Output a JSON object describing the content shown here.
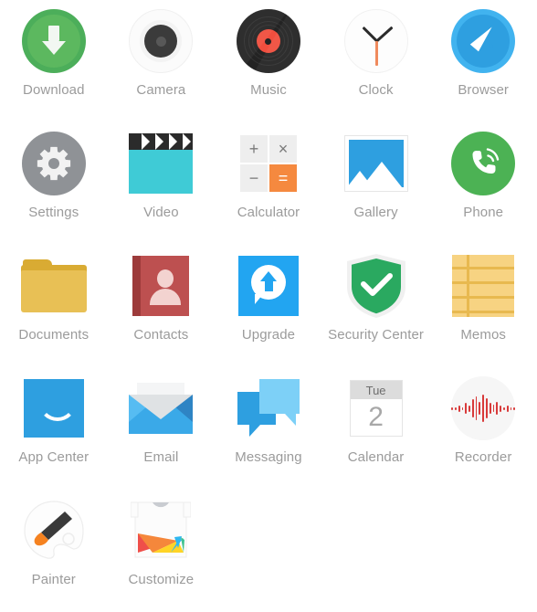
{
  "screen": {
    "name": "app-drawer",
    "background": "#ffffff",
    "columns": 5
  },
  "apps": [
    {
      "label": "Download",
      "icon": "download-icon",
      "colors": {
        "ring": "#4cae5a",
        "fill": "#5cb85f",
        "arrow": "#f2f7f2"
      }
    },
    {
      "label": "Camera",
      "icon": "camera-icon",
      "colors": {
        "ring": "#f3f3f3",
        "lens": "#3b3b3b",
        "pupil": "#585858"
      }
    },
    {
      "label": "Music",
      "icon": "music-icon",
      "colors": {
        "disc": "#232323",
        "label": "#f04e3e"
      }
    },
    {
      "label": "Clock",
      "icon": "clock-icon",
      "colors": {
        "face": "#fdfdfd",
        "hands": "#2b2b2b",
        "second": "#f08a5d"
      }
    },
    {
      "label": "Browser",
      "icon": "compass-icon",
      "colors": {
        "body": "#2e9fe0",
        "ring": "#41b3ef",
        "needle": "#ffffff"
      }
    },
    {
      "label": "Settings",
      "icon": "gear-icon",
      "colors": {
        "circle": "#8f9296",
        "gear": "#f2f2f2"
      }
    },
    {
      "label": "Video",
      "icon": "clapperboard-icon",
      "colors": {
        "top": "#2b2b2b",
        "body": "#3fcbd6"
      }
    },
    {
      "label": "Calculator",
      "icon": "calculator-icon",
      "colors": {
        "key": "#eeeeee",
        "equals": "#f5893f",
        "glyph": "#7a7a7a"
      },
      "keys": [
        "+",
        "×",
        "−",
        "="
      ]
    },
    {
      "label": "Gallery",
      "icon": "photo-icon",
      "colors": {
        "sky": "#2e9fe0",
        "mountain": "#ffffff",
        "frame": "#e6e6e6"
      }
    },
    {
      "label": "Phone",
      "icon": "phone-handset-icon",
      "colors": {
        "circle": "#4cb254",
        "handset": "#ffffff"
      }
    },
    {
      "label": "Documents",
      "icon": "folder-icon",
      "colors": {
        "back": "#d9ab33",
        "front": "#e8c055"
      }
    },
    {
      "label": "Contacts",
      "icon": "address-book-icon",
      "colors": {
        "spine": "#9d3b3b",
        "cover": "#bd5050",
        "person": "#f3d3d0"
      }
    },
    {
      "label": "Upgrade",
      "icon": "upgrade-arrow-icon",
      "colors": {
        "bg": "#22a5f1",
        "balloon": "#ffffff"
      }
    },
    {
      "label": "Security Center",
      "icon": "shield-check-icon",
      "colors": {
        "shield": "#2aa960",
        "outline": "#f0f0f0",
        "check": "#ffffff"
      }
    },
    {
      "label": "Memos",
      "icon": "notepad-icon",
      "colors": {
        "paper": "#f7d382",
        "rule": "#e8b94f"
      }
    },
    {
      "label": "App Center",
      "icon": "shopping-bag-icon",
      "colors": {
        "bag": "#2e9fe0",
        "handle": "#ffffff"
      }
    },
    {
      "label": "Email",
      "icon": "envelope-icon",
      "colors": {
        "front": "#3aa9e8",
        "left": "#56bcf2",
        "right": "#2e84c4",
        "paper": "#f4f5f6"
      }
    },
    {
      "label": "Messaging",
      "icon": "chat-bubbles-icon",
      "colors": {
        "back": "#2e9fe0",
        "front": "#7dd0f7"
      }
    },
    {
      "label": "Calendar",
      "icon": "calendar-icon",
      "weekday": "Tue",
      "day": "2",
      "colors": {
        "header": "#dcdcdc",
        "body": "#ffffff",
        "text": "#a8a8a8"
      }
    },
    {
      "label": "Recorder",
      "icon": "waveform-icon",
      "colors": {
        "circle": "#f6f6f6",
        "wave": "#d83a3a"
      }
    },
    {
      "label": "Painter",
      "icon": "paint-palette-icon",
      "colors": {
        "palette": "#fdfdfd",
        "brush": "#3a3a3a",
        "tip": "#f58220"
      }
    },
    {
      "label": "Customize",
      "icon": "tshirt-icon",
      "colors": {
        "shirt": "#fcfcfc",
        "collar": "#c9ccd1",
        "red": "#ef4f4a",
        "orange": "#f5873b",
        "yellow": "#ffd426",
        "blue": "#2eb7f0",
        "green": "#3ec28f"
      }
    }
  ]
}
